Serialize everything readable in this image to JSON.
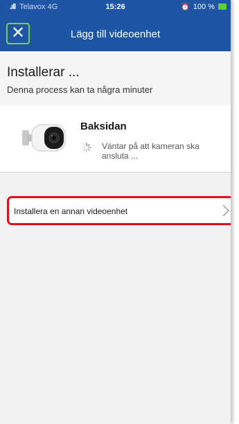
{
  "status_bar": {
    "signal_bars": ".ıll",
    "carrier": "Telavox 4G",
    "time": "15:26",
    "alarm_icon": "⏰",
    "battery": "100 %"
  },
  "nav": {
    "close_glyph": "✕",
    "title": "Lägg till videoenhet"
  },
  "install": {
    "title": "Installerar ...",
    "subtitle": "Denna process kan ta några minuter"
  },
  "device": {
    "name": "Baksidan",
    "status": "Väntar på att kameran ska ansluta ...",
    "icon": "outdoor-camera-icon"
  },
  "other_device": {
    "label": "Installera en annan videoenhet"
  },
  "colors": {
    "header": "#1f55a5",
    "highlight_close": "#7ccf45",
    "highlight_row": "#e3101a",
    "background": "#f2f2f2"
  }
}
